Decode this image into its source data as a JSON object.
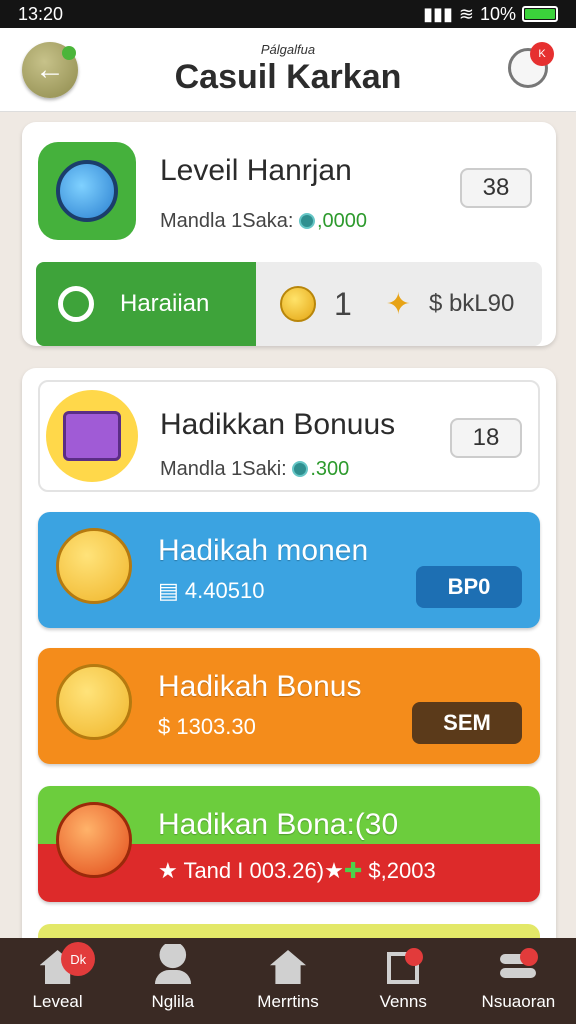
{
  "status_bar": {
    "time": "13:20",
    "battery": "10%"
  },
  "header": {
    "subtitle": "Pálgalfua",
    "title": "Casuil Karkan",
    "chat_badge": "K"
  },
  "level_card": {
    "title": "Leveil Hanrjan",
    "subtitle_label": "Mandla 1Saka:",
    "subtitle_value": ",0000",
    "count": "38",
    "action_label": "Haraiian",
    "coin_count": "1",
    "reward_text": "$ bkL90"
  },
  "bonus_card": {
    "title": "Hadikkan Bonuus",
    "subtitle_label": "Mandla 1Saki:",
    "subtitle_value": ".300",
    "count": "18"
  },
  "banners": [
    {
      "title": "Hadikah monen",
      "subtitle": "4.40510",
      "button": "BP0"
    },
    {
      "title": "Hadikah Bonus",
      "subtitle": "$ 1303.30",
      "button": "SEM"
    },
    {
      "title": "Hadikan Bona:(30",
      "subtitle": "Tand I 003.26)",
      "extra": "$,2003"
    }
  ],
  "bottom_nav": {
    "items": [
      {
        "label": "Leveal",
        "badge": "Dk"
      },
      {
        "label": "Nglila"
      },
      {
        "label": "Merrtins"
      },
      {
        "label": "Venns"
      },
      {
        "label": "Nsuaoran"
      }
    ]
  },
  "colors": {
    "green": "#3ea33a",
    "blue": "#3ba3e1",
    "orange": "#f48c1b",
    "red": "#dd2a2a",
    "nav": "#3a2a24"
  }
}
